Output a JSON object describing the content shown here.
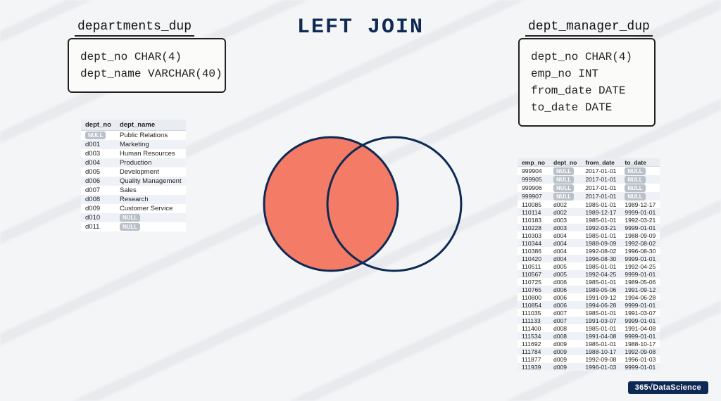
{
  "title": "LEFT JOIN",
  "left_schema": {
    "name": "departments_dup",
    "columns": [
      "dept_no CHAR(4)",
      "dept_name VARCHAR(40)"
    ]
  },
  "right_schema": {
    "name": "dept_manager_dup",
    "columns": [
      "dept_no CHAR(4)",
      "emp_no INT",
      "from_date DATE",
      "to_date DATE"
    ]
  },
  "left_table": {
    "headers": [
      "dept_no",
      "dept_name"
    ],
    "rows": [
      [
        "NULL",
        "Public Relations"
      ],
      [
        "d001",
        "Marketing"
      ],
      [
        "d003",
        "Human Resources"
      ],
      [
        "d004",
        "Production"
      ],
      [
        "d005",
        "Development"
      ],
      [
        "d006",
        "Quality Management"
      ],
      [
        "d007",
        "Sales"
      ],
      [
        "d008",
        "Research"
      ],
      [
        "d009",
        "Customer Service"
      ],
      [
        "d010",
        "NULL"
      ],
      [
        "d011",
        "NULL"
      ]
    ]
  },
  "right_table": {
    "headers": [
      "emp_no",
      "dept_no",
      "from_date",
      "to_date"
    ],
    "rows": [
      [
        "999904",
        "NULL",
        "2017-01-01",
        "NULL"
      ],
      [
        "999905",
        "NULL",
        "2017-01-01",
        "NULL"
      ],
      [
        "999906",
        "NULL",
        "2017-01-01",
        "NULL"
      ],
      [
        "999907",
        "NULL",
        "2017-01-01",
        "NULL"
      ],
      [
        "110085",
        "d002",
        "1985-01-01",
        "1989-12-17"
      ],
      [
        "110114",
        "d002",
        "1989-12-17",
        "9999-01-01"
      ],
      [
        "110183",
        "d003",
        "1985-01-01",
        "1992-03-21"
      ],
      [
        "110228",
        "d003",
        "1992-03-21",
        "9999-01-01"
      ],
      [
        "110303",
        "d004",
        "1985-01-01",
        "1988-09-09"
      ],
      [
        "110344",
        "d004",
        "1988-09-09",
        "1992-08-02"
      ],
      [
        "110386",
        "d004",
        "1992-08-02",
        "1996-08-30"
      ],
      [
        "110420",
        "d004",
        "1996-08-30",
        "9999-01-01"
      ],
      [
        "110511",
        "d005",
        "1985-01-01",
        "1992-04-25"
      ],
      [
        "110567",
        "d005",
        "1992-04-25",
        "9999-01-01"
      ],
      [
        "110725",
        "d006",
        "1985-01-01",
        "1989-05-06"
      ],
      [
        "110765",
        "d006",
        "1989-05-06",
        "1991-09-12"
      ],
      [
        "110800",
        "d006",
        "1991-09-12",
        "1994-06-28"
      ],
      [
        "110854",
        "d006",
        "1994-06-28",
        "9999-01-01"
      ],
      [
        "111035",
        "d007",
        "1985-01-01",
        "1991-03-07"
      ],
      [
        "111133",
        "d007",
        "1991-03-07",
        "9999-01-01"
      ],
      [
        "111400",
        "d008",
        "1985-01-01",
        "1991-04-08"
      ],
      [
        "111534",
        "d008",
        "1991-04-08",
        "9999-01-01"
      ],
      [
        "111692",
        "d009",
        "1985-01-01",
        "1988-10-17"
      ],
      [
        "111784",
        "d009",
        "1988-10-17",
        "1992-09-08"
      ],
      [
        "111877",
        "d009",
        "1992-09-08",
        "1996-01-03"
      ],
      [
        "111939",
        "d009",
        "1996-01-03",
        "9999-01-01"
      ]
    ]
  },
  "venn": {
    "left_fill": "#f47b66",
    "right_fill": "none",
    "stroke": "#0e2a54"
  },
  "watermark": "365√DataScience"
}
